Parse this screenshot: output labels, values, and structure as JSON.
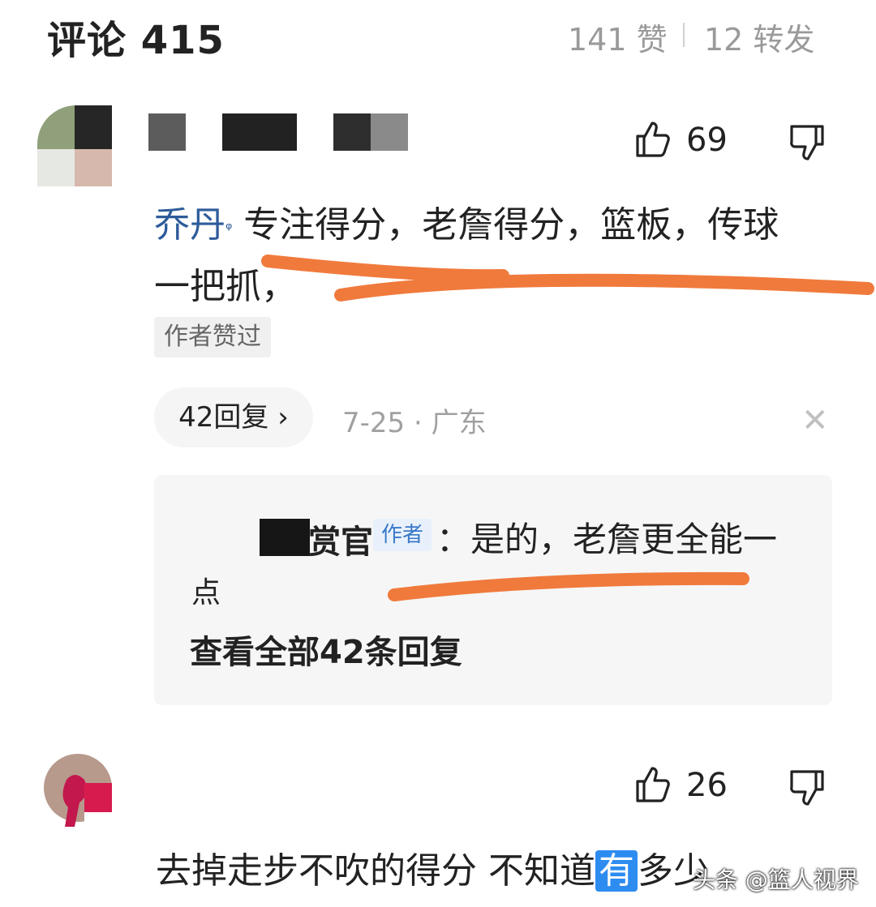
{
  "header": {
    "title": "评论 415",
    "likes": "141 赞",
    "shares": "12 转发"
  },
  "comments": [
    {
      "likes": "69",
      "mention": "乔丹",
      "text_line1": " 专注得分，老詹得分，篮板，传球",
      "text_line2": "一把抓，",
      "author_liked": "作者赞过",
      "reply_count": "42回复",
      "meta": "7-25 · 广东",
      "reply": {
        "author_suffix": "赏官",
        "author_tag": "作者",
        "text_line1": "：是的，老詹更全能一",
        "text_line2": "点",
        "view_all": "查看全部42条回复"
      }
    },
    {
      "likes": "26",
      "text_before": "去掉走步不吹的得分 不知道",
      "text_highlight": "有",
      "text_after": "多少"
    }
  ],
  "watermark": "头条 @篮人视界",
  "colors": {
    "accent_blue": "#2e5c9a",
    "author_tag_bg": "#e8f1fb",
    "orange_underline": "#f07a3c"
  },
  "icons": {
    "like": "thumbs-up-icon",
    "dislike": "thumbs-down-icon",
    "close": "close-icon",
    "chevron": "chevron-right-icon"
  }
}
